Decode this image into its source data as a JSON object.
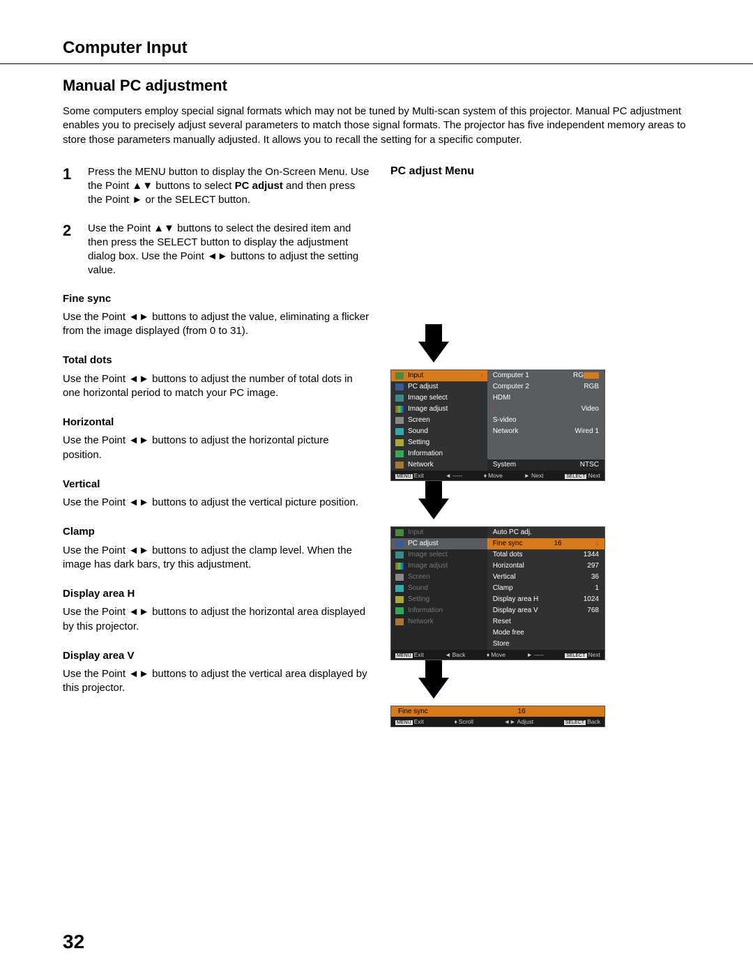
{
  "header": "Computer Input",
  "title": "Manual PC adjustment",
  "intro": "Some computers employ special signal formats which may not be tuned by Multi-scan system of this projector. Manual PC adjustment enables you to precisely adjust several parameters to match those signal formats. The projector has five independent memory areas to store those parameters manually adjusted. It allows you to recall the setting for a specific computer.",
  "steps": [
    {
      "num": "1",
      "pre": "Press the MENU button to display the On-Screen Menu. Use the Point ▲▼ buttons to select ",
      "bold": "PC adjust",
      "post": " and then press the Point ► or the SELECT button."
    },
    {
      "num": "2",
      "pre": "Use the Point ▲▼ buttons to select the desired item and then press the SELECT button to display the adjustment dialog box. Use the Point ◄► buttons to adjust the setting value.",
      "bold": "",
      "post": ""
    }
  ],
  "params": [
    {
      "t": "Fine sync",
      "d": "Use the Point ◄► buttons to adjust the value, eliminating a flicker from the image displayed (from 0 to 31)."
    },
    {
      "t": "Total dots",
      "d": "Use the Point ◄► buttons to adjust the number of total dots in one horizontal period to match your PC image."
    },
    {
      "t": "Horizontal",
      "d": "Use the Point ◄► buttons to adjust the horizontal picture position."
    },
    {
      "t": "Vertical",
      "d": "Use the Point ◄► buttons to adjust the vertical picture position."
    },
    {
      "t": "Clamp",
      "d": "Use the Point ◄► buttons to adjust the clamp level. When the image has dark bars, try this adjustment."
    },
    {
      "t": "Display area H",
      "d": "Use the Point ◄► buttons to adjust the horizontal area displayed by this projector."
    },
    {
      "t": "Display area V",
      "d": "Use the Point ◄► buttons to adjust the vertical area displayed by this projector."
    }
  ],
  "right_title": "PC adjust Menu",
  "osd1": {
    "left_items": [
      "Input",
      "PC adjust",
      "Image select",
      "Image adjust",
      "Screen",
      "Sound",
      "Setting",
      "Information",
      "Network"
    ],
    "right_items": [
      {
        "l": "Computer 1",
        "r": "RG"
      },
      {
        "l": "Computer 2",
        "r": "RGB"
      },
      {
        "l": "HDMI",
        "r": ""
      },
      {
        "l": "Video",
        "r": ""
      },
      {
        "l": "S-video",
        "r": ""
      },
      {
        "l": "Network",
        "r": "Wired 1"
      }
    ],
    "sys": {
      "l": "System",
      "r": "NTSC"
    },
    "foot": [
      "Exit",
      "-----",
      "Move",
      "Next",
      "Next"
    ],
    "foot_prefix": [
      "MENU",
      "◄",
      "♦",
      "►",
      "SELECT"
    ]
  },
  "osd2": {
    "left_items": [
      "Input",
      "PC adjust",
      "Image select",
      "Image adjust",
      "Screen",
      "Sound",
      "Setting",
      "Information",
      "Network"
    ],
    "right_items": [
      {
        "l": "Auto PC adj.",
        "r": ""
      },
      {
        "l": "Fine sync",
        "r": "16"
      },
      {
        "l": "Total dots",
        "r": "1344"
      },
      {
        "l": "Horizontal",
        "r": "297"
      },
      {
        "l": "Vertical",
        "r": "36"
      },
      {
        "l": "Clamp",
        "r": "1"
      },
      {
        "l": "Display area H",
        "r": "1024"
      },
      {
        "l": "Display area V",
        "r": "768"
      },
      {
        "l": "Reset",
        "r": ""
      },
      {
        "l": "Mode free",
        "r": ""
      },
      {
        "l": "Store",
        "r": ""
      }
    ],
    "foot": [
      "Exit",
      "Back",
      "Move",
      "-----",
      "Next"
    ],
    "foot_prefix": [
      "MENU",
      "◄",
      "♦",
      "►",
      "SELECT"
    ]
  },
  "osd3": {
    "title": "Fine sync",
    "value": "16",
    "foot": [
      "Exit",
      "Scroll",
      "Adjust",
      "Back"
    ],
    "foot_prefix": [
      "MENU",
      "♦",
      "◄►",
      "SELECT"
    ]
  },
  "page_num": "32"
}
